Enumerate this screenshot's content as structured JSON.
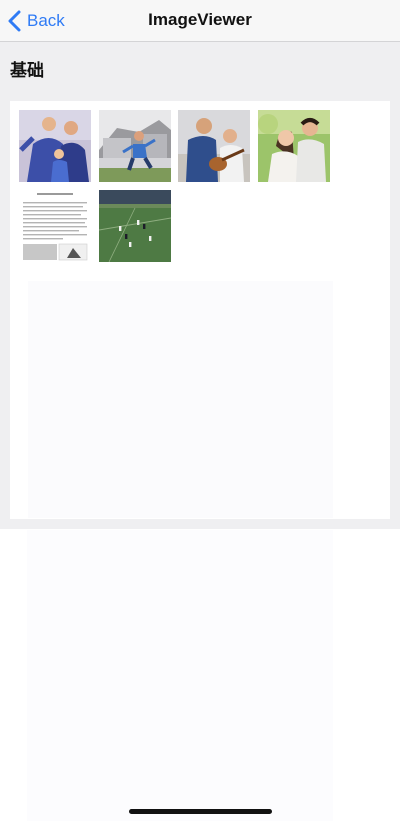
{
  "nav": {
    "back_label": "Back",
    "title": "ImageViewer"
  },
  "section": {
    "title": "基础"
  },
  "thumbnails": [
    {
      "name": "family-photo-thumbnail",
      "icon": "family-photo"
    },
    {
      "name": "child-running-photo-thumbnail",
      "icon": "child-running-photo"
    },
    {
      "name": "father-daughter-guitar-thumbnail",
      "icon": "guitar-photo"
    },
    {
      "name": "couple-photo-thumbnail",
      "icon": "couple-photo"
    },
    {
      "name": "document-page-thumbnail",
      "icon": "document-photo"
    },
    {
      "name": "soccer-match-thumbnail",
      "icon": "soccer-photo"
    }
  ]
}
